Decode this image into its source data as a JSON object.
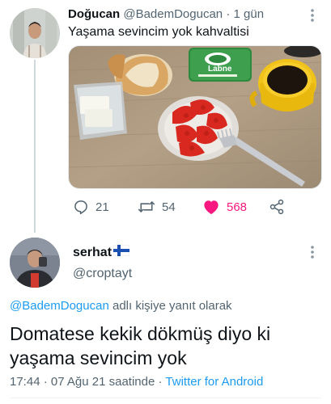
{
  "parent_tweet": {
    "author_name": "Doğucan",
    "author_handle": "@BademDogucan",
    "separator": "·",
    "time": "1 gün",
    "text": "Yaşama sevincim yok kahvaltisi",
    "photo": {
      "package_brand": "Labne"
    },
    "actions": {
      "replies": "21",
      "retweets": "54",
      "likes": "568",
      "like_color": "#f91880"
    }
  },
  "reply_tweet": {
    "author_name": "serhat",
    "author_handle": "@croptayt",
    "flag_icon": "finland-flag-icon",
    "replying_to_handle": "@BademDogucan",
    "replying_to_suffix": " adlı kişiye yanıt olarak",
    "text": "Domatese kekik dökmüş diyo ki yaşama sevincim yok",
    "time": "17:44",
    "date": "07 Ağu 21 saatinde",
    "separator": "·",
    "source": "Twitter for Android"
  },
  "colors": {
    "link": "#1d9bf0",
    "muted": "#536471",
    "text": "#0f1419"
  }
}
